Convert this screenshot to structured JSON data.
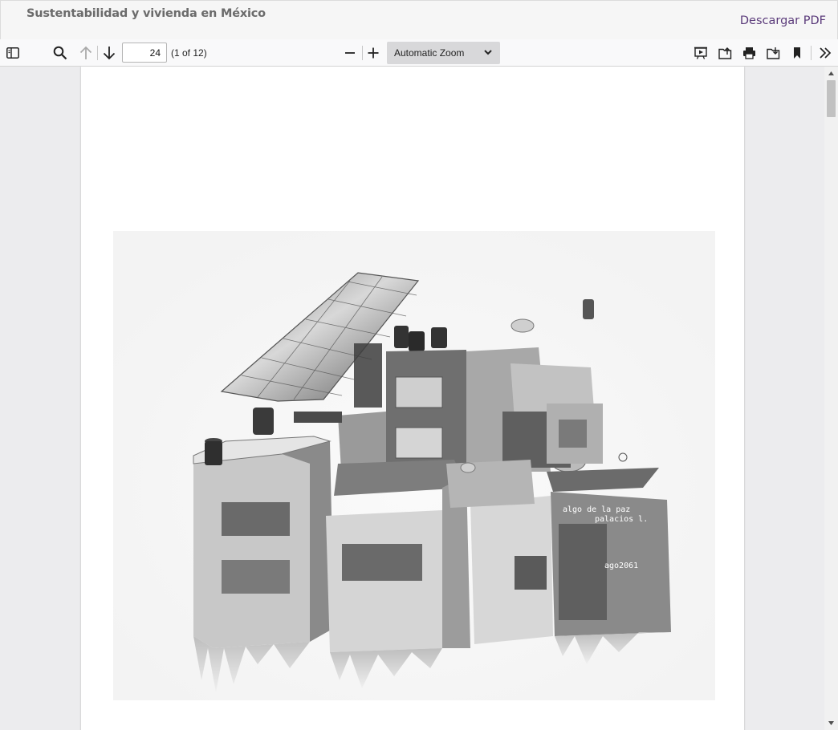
{
  "header": {
    "title": "Sustentabilidad y vivienda en México",
    "download_label": "Descargar PDF"
  },
  "toolbar": {
    "page_number": "24",
    "page_count": "(1 of 12)",
    "zoom": "Automatic Zoom",
    "icons": {
      "sidebar": "sidebar-toggle-icon",
      "find": "search-icon",
      "previous": "arrow-up-icon",
      "next": "arrow-down-icon",
      "zoom_out": "minus-icon",
      "zoom_in": "plus-icon",
      "presentation": "presentation-icon",
      "open": "open-file-icon",
      "print": "print-icon",
      "download": "download-icon",
      "bookmark": "bookmark-icon",
      "tools": "double-chevron-icon"
    }
  },
  "page": {
    "artwork_text_line1": "algo de la paz",
    "artwork_text_line2": "palacios l.",
    "artwork_signature": "ago2061"
  },
  "colors": {
    "accent": "#5a3a7a",
    "viewer_bg": "#ececee"
  }
}
